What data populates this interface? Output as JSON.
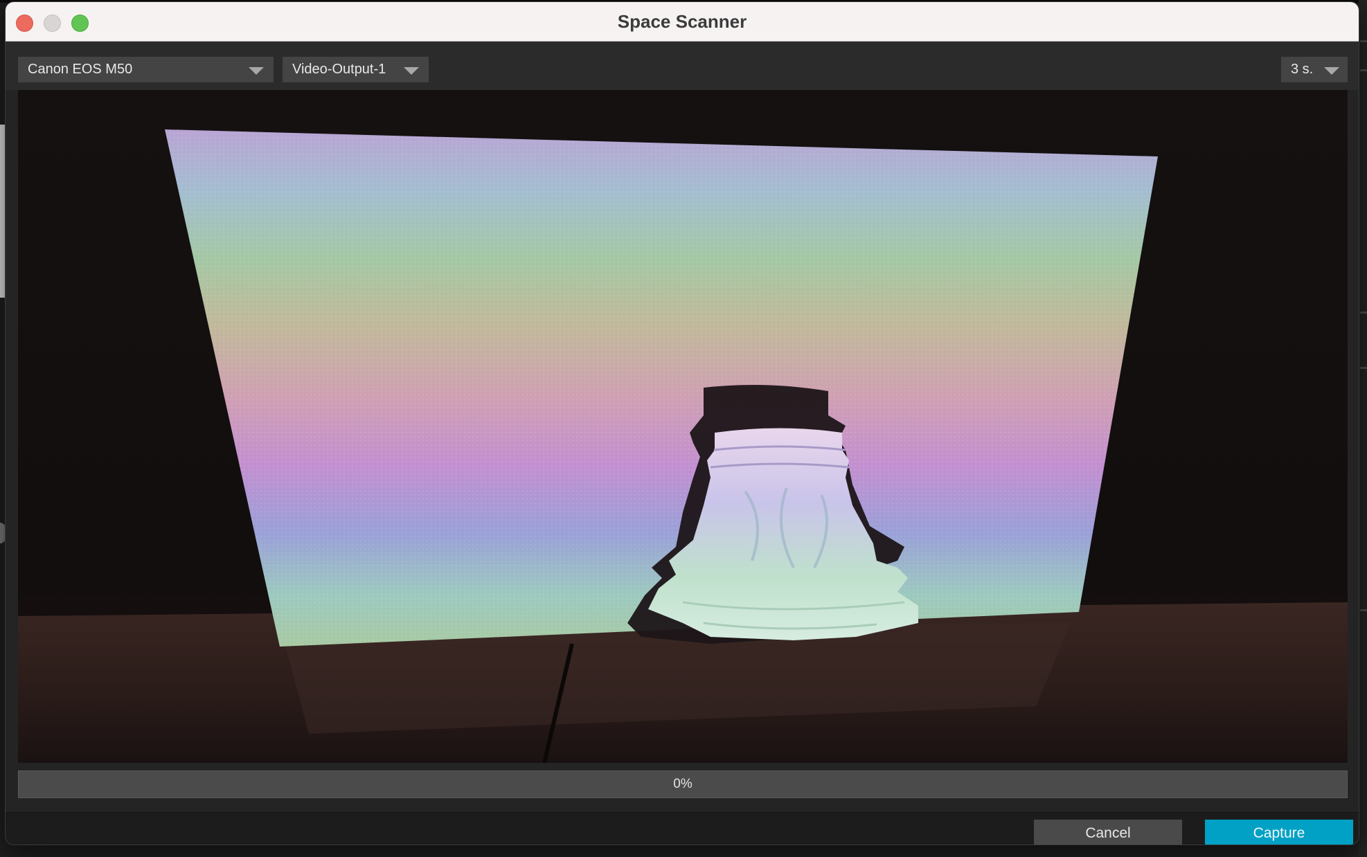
{
  "window": {
    "title": "Space Scanner"
  },
  "toolbar": {
    "camera_select": {
      "value": "Canon EOS M50"
    },
    "output_select": {
      "value": "Video-Output-1"
    },
    "delay_select": {
      "value": "3 s."
    }
  },
  "preview": {
    "description_icon": "camera-preview-image"
  },
  "progress": {
    "text": "0%",
    "value": 0
  },
  "footer": {
    "cancel_label": "Cancel",
    "capture_label": "Capture"
  },
  "colors": {
    "accent": "#00a1c5",
    "window_bg": "#242424",
    "titlebar_bg": "#f6f2f2"
  }
}
